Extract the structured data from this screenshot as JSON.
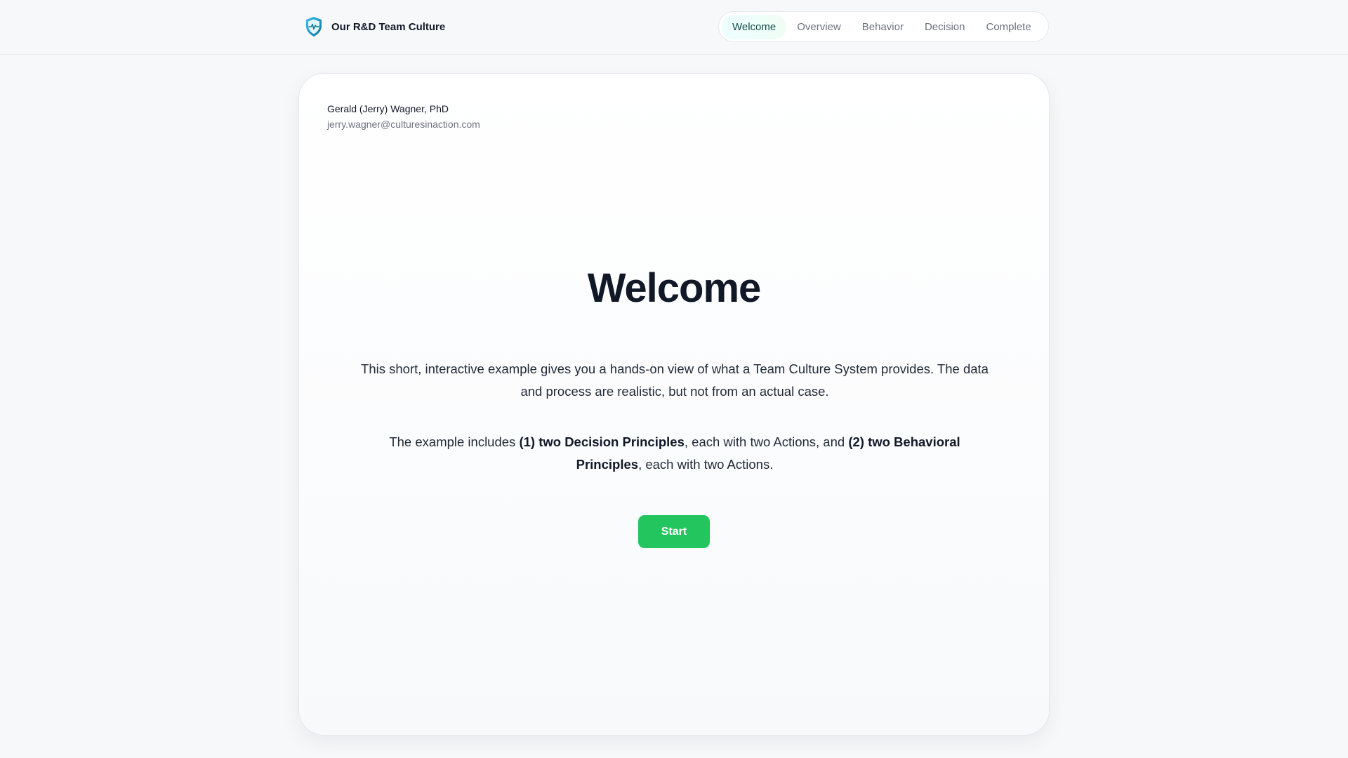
{
  "header": {
    "brand_icon": "shield-heartbeat-icon",
    "title": "Our R&D Team Culture",
    "nav": [
      {
        "label": "Welcome",
        "active": true
      },
      {
        "label": "Overview",
        "active": false
      },
      {
        "label": "Behavior",
        "active": false
      },
      {
        "label": "Decision",
        "active": false
      },
      {
        "label": "Complete",
        "active": false
      }
    ]
  },
  "author": {
    "name": "Gerald (Jerry) Wagner, PhD",
    "email": "jerry.wagner@culturesinaction.com"
  },
  "main": {
    "heading": "Welcome",
    "intro": "This short, interactive example gives you a hands-on view of what a Team Culture System provides. The data and process are realistic, but not from an actual case.",
    "includes": {
      "prefix": "The example includes ",
      "bold1": "(1) two Decision Principles",
      "mid": ", each with two Actions, and ",
      "bold2": "(2) two Behavioral Principles",
      "suffix": ", each with two Actions."
    },
    "start_label": "Start"
  },
  "colors": {
    "accent": "#22c55e",
    "active_tab_bg": "#ecfeff",
    "background": "#f7f8fa"
  }
}
